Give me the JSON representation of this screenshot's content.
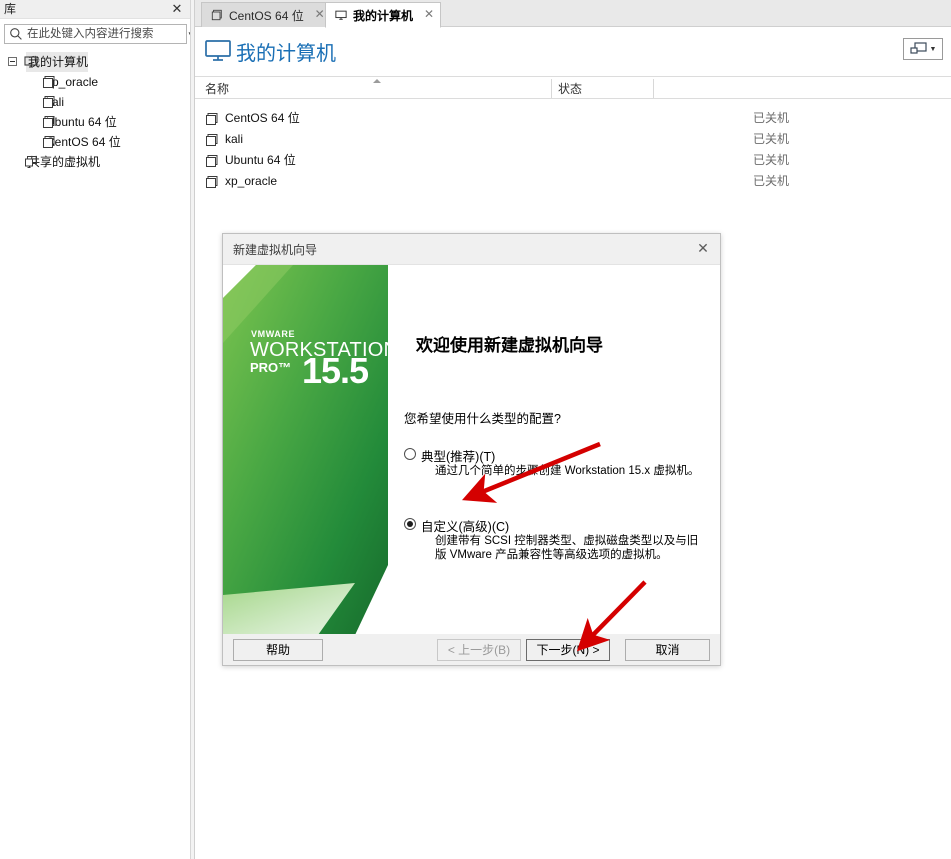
{
  "sidebar": {
    "library_title": "库",
    "close_icon": "close-icon",
    "search": {
      "placeholder": "在此处键入内容进行搜索",
      "value": "",
      "icon": "search-icon",
      "caret_icon": "chevron-down-icon"
    },
    "tree": [
      {
        "label": "我的计算机",
        "level": 0,
        "icon": "monitor-icon",
        "expanded": true,
        "selected": true
      },
      {
        "label": "xp_oracle",
        "level": 1,
        "icon": "vm-icon",
        "selected": false
      },
      {
        "label": "kali",
        "level": 1,
        "icon": "vm-icon",
        "selected": false
      },
      {
        "label": "Ubuntu 64 位",
        "level": 1,
        "icon": "vm-icon",
        "selected": false
      },
      {
        "label": "CentOS 64 位",
        "level": 1,
        "icon": "vm-icon",
        "selected": false
      },
      {
        "label": "共享的虚拟机",
        "level": 0,
        "icon": "shared-vm-icon",
        "selected": false
      }
    ]
  },
  "tabs": [
    {
      "label": "CentOS 64 位",
      "icon": "vm-icon",
      "active": false,
      "close_icon": "close-icon"
    },
    {
      "label": "我的计算机",
      "icon": "monitor-icon",
      "active": true,
      "close_icon": "close-icon"
    }
  ],
  "page": {
    "title": "我的计算机",
    "title_icon": "monitor-icon",
    "title_color": "#1a6fb5",
    "view_button": {
      "icon": "display-layout-icon",
      "caret_icon": "chevron-down-icon"
    }
  },
  "grid": {
    "columns": [
      {
        "label": "名称",
        "sorted": "asc",
        "sort_icon": "sort-ascending-icon"
      },
      {
        "label": "状态"
      }
    ],
    "rows": [
      {
        "name": "CentOS 64 位",
        "state": "已关机",
        "icon": "vm-icon"
      },
      {
        "name": "kali",
        "state": "已关机",
        "icon": "vm-icon"
      },
      {
        "name": "Ubuntu 64 位",
        "state": "已关机",
        "icon": "vm-icon"
      },
      {
        "name": "xp_oracle",
        "state": "已关机",
        "icon": "vm-icon"
      }
    ]
  },
  "dialog": {
    "title": "新建虚拟机向导",
    "close_icon": "close-icon",
    "banner": {
      "vendor": "VMWARE",
      "product": "WORKSTATION",
      "edition": "PRO™",
      "version": "15.5",
      "color_light": "#6cbf4a",
      "color_dark": "#1f7a34"
    },
    "heading": "欢迎使用新建虚拟机向导",
    "question": "您希望使用什么类型的配置?",
    "options": [
      {
        "label": "典型(推荐)(T)",
        "description": "通过几个简单的步骤创建 Workstation 15.x 虚拟机。",
        "selected": false
      },
      {
        "label": "自定义(高级)(C)",
        "description": "创建带有 SCSI 控制器类型、虚拟磁盘类型以及与旧版 VMware 产品兼容性等高级选项的虚拟机。",
        "selected": true
      }
    ],
    "buttons": {
      "help": "帮助",
      "back": "< 上一步(B)",
      "next": "下一步(N) >",
      "cancel": "取消"
    }
  },
  "annotations": {
    "arrow_color": "#d40000",
    "arrows": [
      {
        "target": "custom-radio-option",
        "points_to": "自定义(高级)(C)"
      },
      {
        "target": "next-button",
        "points_to": "下一步(N) >"
      }
    ]
  }
}
